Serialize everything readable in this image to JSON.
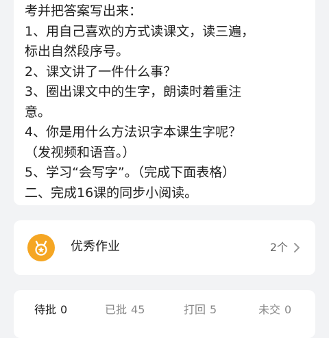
{
  "instructions": {
    "lines": [
      "考并把答案写出来：",
      "1、用自己喜欢的方式读课文，读三遍，",
      "标出自然段序号。",
      "2、课文讲了一件什么事？",
      "3、圈出课文中的生字，朗读时着重注",
      "意。",
      "4、你是用什么方法识字本课生字呢？",
      "（发视频和语音。）",
      "5、学习“会写字”。（完成下面表格）",
      "二、完成16课的同步小阅读。"
    ]
  },
  "award": {
    "title": "优秀作业",
    "count": "2个",
    "icon": "medal-icon",
    "color": "#f5a623"
  },
  "tabs": [
    {
      "label": "待批",
      "count": "0"
    },
    {
      "label": "已批",
      "count": "45"
    },
    {
      "label": "打回",
      "count": "5"
    },
    {
      "label": "未交",
      "count": "0"
    }
  ]
}
